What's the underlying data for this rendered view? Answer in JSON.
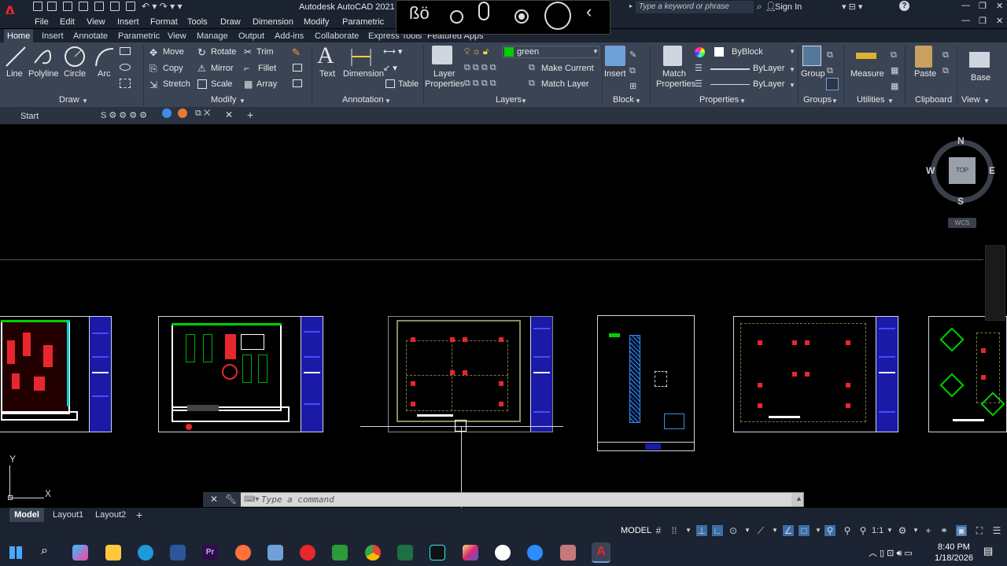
{
  "app": {
    "title": "Autodesk AutoCAD 2021",
    "logo": "A",
    "search_placeholder": "Type a keyword or phrase",
    "sign_in": "Sign In"
  },
  "menu": [
    "File",
    "Edit",
    "View",
    "Insert",
    "Format",
    "Tools",
    "Draw",
    "Dimension",
    "Modify",
    "Parametric"
  ],
  "ribbon_tabs": [
    "Home",
    "Insert",
    "Annotate",
    "Parametric",
    "View",
    "Manage",
    "Output",
    "Add-ins",
    "Collaborate",
    "Express Tools",
    "Featured Apps"
  ],
  "ribbon": {
    "draw": {
      "title": "Draw",
      "line": "Line",
      "polyline": "Polyline",
      "circle": "Circle",
      "arc": "Arc"
    },
    "modify": {
      "title": "Modify",
      "move": "Move",
      "rotate": "Rotate",
      "trim": "Trim",
      "copy": "Copy",
      "mirror": "Mirror",
      "fillet": "Fillet",
      "stretch": "Stretch",
      "scale": "Scale",
      "array": "Array"
    },
    "annotation": {
      "title": "Annotation",
      "text": "Text",
      "dimension": "Dimension",
      "table": "Table"
    },
    "layers": {
      "title": "Layers",
      "layer_properties_1": "Layer",
      "layer_properties_2": "Properties",
      "current_layer": "green",
      "make_current": "Make Current",
      "match_layer": "Match Layer"
    },
    "block": {
      "title": "Block",
      "insert": "Insert"
    },
    "properties": {
      "title": "Properties",
      "match_1": "Match",
      "match_2": "Properties",
      "color": "ByBlock",
      "linetype": "ByLayer",
      "lineweight": "ByLayer"
    },
    "groups": {
      "title": "Groups",
      "group": "Group"
    },
    "utilities": {
      "title": "Utilities",
      "measure": "Measure"
    },
    "clipboard": {
      "title": "Clipboard",
      "paste": "Paste"
    },
    "view": {
      "title": "View",
      "base": "Base"
    }
  },
  "file_tabs": {
    "start": "Start"
  },
  "viewcube": {
    "top": "TOP",
    "n": "N",
    "s": "S",
    "e": "E",
    "w": "W",
    "wcs": "WCS"
  },
  "ucs": {
    "x": "X",
    "y": "Y"
  },
  "command": {
    "placeholder": "Type a command"
  },
  "layout_tabs": [
    "Model",
    "Layout1",
    "Layout2"
  ],
  "status": {
    "model": "MODEL",
    "scale": "1:1"
  },
  "clock": {
    "time": "8:40 PM",
    "date": "1/18/2026"
  },
  "colors": {
    "accent_red": "#e8262d",
    "ribbon_bg": "#3b4455",
    "titlebar_bg": "#1b2230",
    "layer_green": "#00d000"
  }
}
